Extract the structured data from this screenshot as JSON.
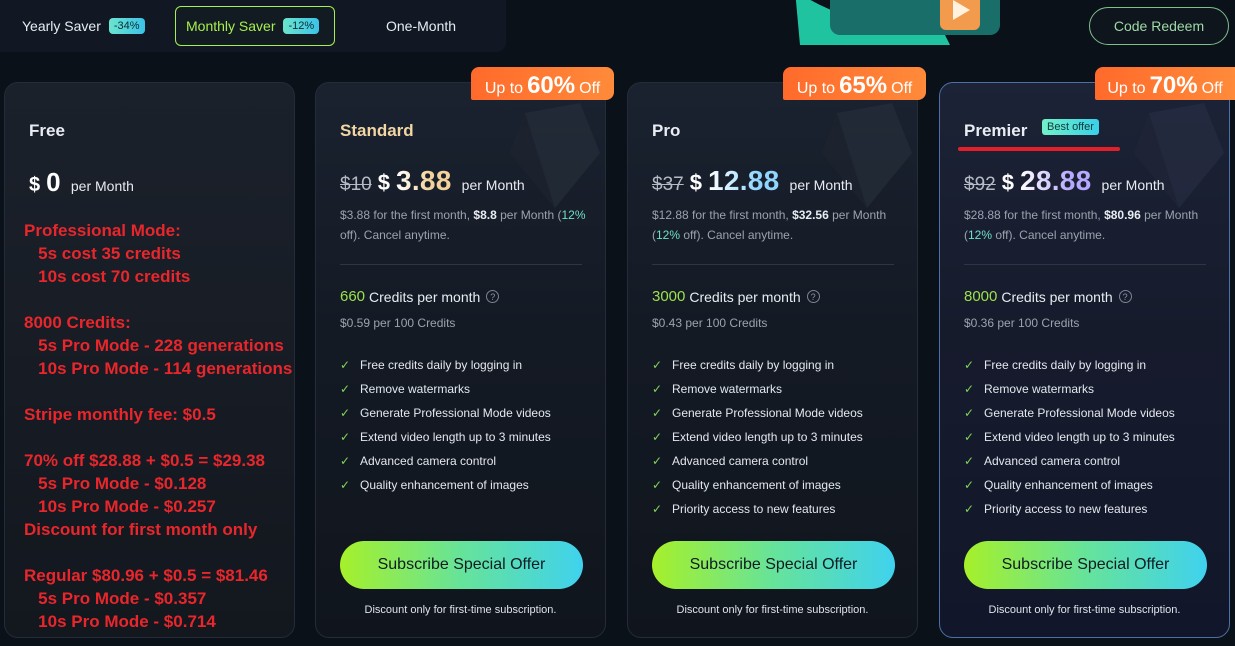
{
  "tabs": [
    {
      "label": "Yearly Saver",
      "badge": "-34%"
    },
    {
      "label": "Monthly Saver",
      "badge": "-12%"
    },
    {
      "label": "One-Month",
      "badge": ""
    }
  ],
  "code_redeem": "Code Redeem",
  "free": {
    "name": "Free",
    "currency": "$",
    "amount": "0",
    "per": "per Month",
    "annotations": [
      "Professional Mode:",
      "   5s cost 35 credits",
      "   10s cost 70 credits",
      "",
      "8000 Credits:",
      "   5s Pro Mode - 228 generations",
      "   10s Pro Mode - 114 generations",
      "",
      "Stripe monthly fee: $0.5",
      "",
      "70% off $28.88 + $0.5 = $29.38",
      "   5s Pro Mode - $0.128",
      "   10s Pro Mode - $0.257",
      "Discount for first month only",
      "",
      "Regular $80.96 + $0.5 = $81.46",
      "   5s Pro Mode - $0.357",
      "   10s Pro Mode - $0.714"
    ]
  },
  "plans": [
    {
      "name": "Standard",
      "tag_prefix": "Up to",
      "tag_value": "60%",
      "tag_suffix": "Off",
      "old_price": "$10",
      "currency": "$",
      "amount": "3.88",
      "per": "per Month",
      "note_a": "$3.88 for the first month, ",
      "note_b": "$8.8",
      "note_c": " per Month",
      "note_pct": "12%",
      "note_d": " off). Cancel anytime.",
      "credits": "660",
      "credits_label": "Credits per month",
      "per_credit": "$0.59 per 100 Credits",
      "features": [
        "Free credits daily by logging in",
        "Remove watermarks",
        "Generate Professional Mode videos",
        "Extend video length up to 3 minutes",
        "Advanced camera control",
        "Quality enhancement of images"
      ],
      "button": "Subscribe Special Offer",
      "sub_note": "Discount only for first-time subscription."
    },
    {
      "name": "Pro",
      "tag_prefix": "Up to",
      "tag_value": "65%",
      "tag_suffix": "Off",
      "old_price": "$37",
      "currency": "$",
      "amount": "12.88",
      "per": "per Month",
      "note_a": "$12.88 for the first month, ",
      "note_b": "$32.56",
      "note_c": " per Month",
      "note_pct": "12%",
      "note_d": " off). Cancel anytime.",
      "credits": "3000",
      "credits_label": "Credits per month",
      "per_credit": "$0.43 per 100 Credits",
      "features": [
        "Free credits daily by logging in",
        "Remove watermarks",
        "Generate Professional Mode videos",
        "Extend video length up to 3 minutes",
        "Advanced camera control",
        "Quality enhancement of images",
        "Priority access to new features"
      ],
      "button": "Subscribe Special Offer",
      "sub_note": "Discount only for first-time subscription."
    },
    {
      "name": "Premier",
      "badge": "Best offer",
      "tag_prefix": "Up to",
      "tag_value": "70%",
      "tag_suffix": "Off",
      "old_price": "$92",
      "currency": "$",
      "amount": "28.88",
      "per": "per Month",
      "note_a": "$28.88 for the first month, ",
      "note_b": "$80.96",
      "note_c": " per Month",
      "note_pct": "12%",
      "note_d": " off). Cancel anytime.",
      "credits": "8000",
      "credits_label": "Credits per month",
      "per_credit": "$0.36 per 100 Credits",
      "features": [
        "Free credits daily by logging in",
        "Remove watermarks",
        "Generate Professional Mode videos",
        "Extend video length up to 3 minutes",
        "Advanced camera control",
        "Quality enhancement of images",
        "Priority access to new features"
      ],
      "button": "Subscribe Special Offer",
      "sub_note": "Discount only for first-time subscription."
    }
  ]
}
